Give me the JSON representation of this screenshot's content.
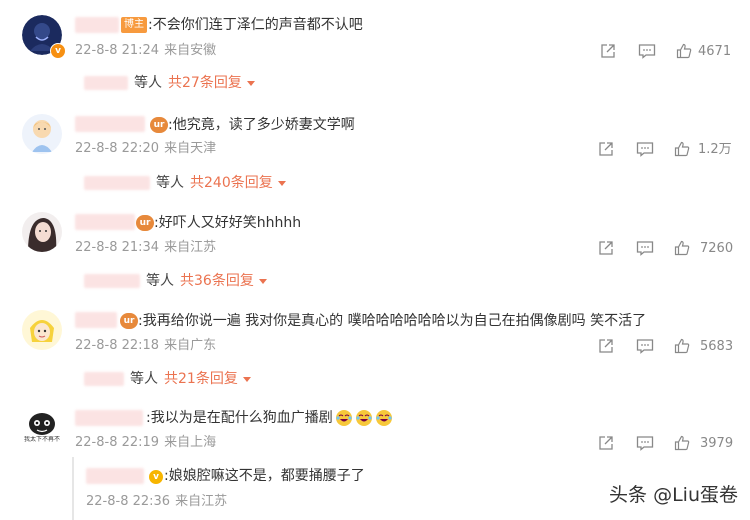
{
  "comments": [
    {
      "tag": "博主",
      "text": ":不会你们连丁泽仁的声音都不认吧",
      "date": "22-8-8 21:24",
      "location": "来自安徽",
      "likes": "4671",
      "reply_who": "等人",
      "reply_more": "共27条回复"
    },
    {
      "text": ":他究竟，读了多少娇妻文学啊",
      "date": "22-8-8 22:20",
      "location": "来自天津",
      "likes": "1.2万",
      "reply_who": "等人",
      "reply_more": "共240条回复"
    },
    {
      "text": ":好吓人又好好笑hhhhh",
      "date": "22-8-8 21:34",
      "location": "来自江苏",
      "likes": "7260",
      "reply_who": "等人",
      "reply_more": "共36条回复"
    },
    {
      "text": ":我再给你说一遍 我对你是真心的 噗哈哈哈哈哈哈以为自己在拍偶像剧吗 笑不活了",
      "date": "22-8-8 22:18",
      "location": "来自广东",
      "likes": "5683",
      "reply_who": "等人",
      "reply_more": "共21条回复"
    },
    {
      "avatar_caption": "我太下不再不",
      "text": ":我以为是在配什么狗血广播剧",
      "date": "22-8-8 22:19",
      "location": "来自上海",
      "likes": "3979"
    }
  ],
  "sub_reply": {
    "text": ":娘娘腔嘛这不是，都要捅腰子了",
    "date": "22-8-8 22:36",
    "location": "来自江苏"
  },
  "watermark": "头条 @Liu蛋卷",
  "colors": {
    "accent": "#eb7350",
    "meta": "#9a9a9a",
    "badge": "#f79a3e"
  }
}
